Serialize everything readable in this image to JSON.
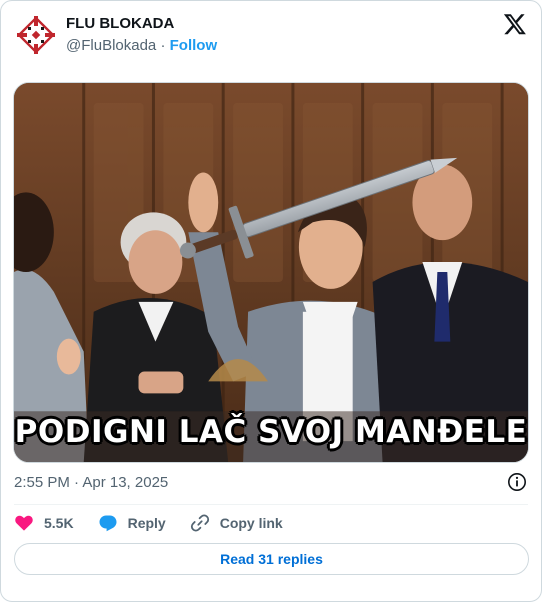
{
  "author": {
    "name": "FLU BLOKADA",
    "handle": "@FluBlokada",
    "separator": " · ",
    "follow_label": "Follow"
  },
  "media": {
    "caption": "PODIGNI LAČ SVOJ MANĐELE"
  },
  "timestamp": "2:55 PM · Apr 13, 2025",
  "actions": {
    "likes_count": "5.5K",
    "reply_label": "Reply",
    "copy_link_label": "Copy link"
  },
  "read_replies_label": "Read 31 replies",
  "colors": {
    "accent": "#1d9bf0",
    "like": "#f91880",
    "reply_icon": "#1d9bf0",
    "logo_red": "#c0262d"
  },
  "icons": [
    "flu-blokada-logo",
    "x-logo-icon",
    "info-icon",
    "heart-icon",
    "reply-bubble-icon",
    "link-icon"
  ]
}
